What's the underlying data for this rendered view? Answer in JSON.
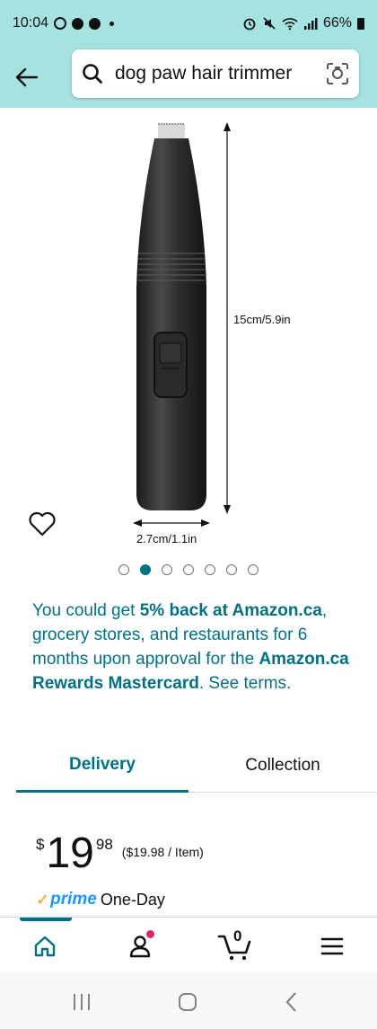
{
  "status_bar": {
    "time": "10:04",
    "battery": "66%"
  },
  "search": {
    "query": "dog paw hair trimmer"
  },
  "product_image": {
    "height_label": "15cm/5.9in",
    "width_label": "2.7cm/1.1in"
  },
  "carousel": {
    "count": 7,
    "active_index": 1
  },
  "promo": {
    "part1": "You could get ",
    "highlight1": "5% back at Amazon.ca",
    "part2": ", grocery stores, and restaurants for 6 months upon approval for the ",
    "highlight2": "Amazon.ca Rewards Mastercard",
    "part3": ". See terms."
  },
  "tabs": [
    {
      "label": "Delivery",
      "active": true
    },
    {
      "label": "Collection",
      "active": false
    }
  ],
  "price": {
    "symbol": "$",
    "whole": "19",
    "fraction": "98",
    "unit_price": "($19.98 / Item)"
  },
  "prime": {
    "check": "✓",
    "word": "prime",
    "delivery": "One-Day"
  },
  "bottom_nav": {
    "items": [
      "home",
      "account",
      "cart",
      "menu"
    ],
    "cart_count": "0"
  },
  "colors": {
    "header_bg": "#a5e3e0",
    "link_teal": "#007185",
    "prime_blue": "#1a98ff",
    "badge_pink": "#e3226c"
  }
}
